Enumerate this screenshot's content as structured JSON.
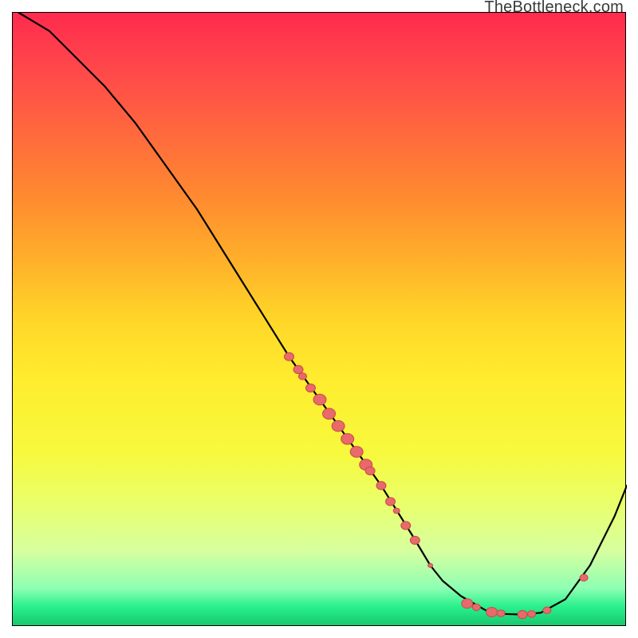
{
  "watermark": "TheBottleneck.com",
  "chart_data": {
    "type": "line",
    "title": "",
    "xlabel": "",
    "ylabel": "",
    "xlim": [
      0,
      100
    ],
    "ylim": [
      0,
      100
    ],
    "grid": false,
    "series": [
      {
        "name": "curve",
        "x": [
          1,
          6,
          10,
          15,
          20,
          25,
          30,
          35,
          40,
          45,
          50,
          55,
          60,
          65,
          68,
          70,
          73,
          77,
          80,
          83,
          86,
          90,
          94,
          98,
          100
        ],
        "y": [
          100,
          97,
          93,
          88,
          82,
          75,
          68,
          60,
          52,
          44,
          37,
          30,
          23,
          15,
          10,
          7.5,
          5,
          2.7,
          2.1,
          2.0,
          2.3,
          4.5,
          10,
          18,
          23
        ]
      }
    ],
    "markers": [
      {
        "x": 45.0,
        "y": 44.0,
        "r": 6
      },
      {
        "x": 46.5,
        "y": 41.9,
        "r": 6
      },
      {
        "x": 47.2,
        "y": 40.8,
        "r": 5
      },
      {
        "x": 48.5,
        "y": 38.9,
        "r": 6
      },
      {
        "x": 50.0,
        "y": 37.0,
        "r": 8
      },
      {
        "x": 51.5,
        "y": 34.7,
        "r": 8
      },
      {
        "x": 53.0,
        "y": 32.7,
        "r": 8
      },
      {
        "x": 54.5,
        "y": 30.6,
        "r": 8
      },
      {
        "x": 56.0,
        "y": 28.5,
        "r": 8
      },
      {
        "x": 57.5,
        "y": 26.4,
        "r": 8
      },
      {
        "x": 58.2,
        "y": 25.4,
        "r": 6
      },
      {
        "x": 60.0,
        "y": 23.0,
        "r": 6
      },
      {
        "x": 61.5,
        "y": 20.4,
        "r": 6
      },
      {
        "x": 62.5,
        "y": 18.9,
        "r": 4
      },
      {
        "x": 64.0,
        "y": 16.5,
        "r": 6
      },
      {
        "x": 65.5,
        "y": 14.1,
        "r": 6
      },
      {
        "x": 68.0,
        "y": 10.0,
        "r": 3
      },
      {
        "x": 74.0,
        "y": 3.8,
        "r": 7
      },
      {
        "x": 75.5,
        "y": 3.2,
        "r": 5
      },
      {
        "x": 78.0,
        "y": 2.4,
        "r": 7
      },
      {
        "x": 79.5,
        "y": 2.2,
        "r": 5
      },
      {
        "x": 83.0,
        "y": 2.0,
        "r": 6
      },
      {
        "x": 84.5,
        "y": 2.1,
        "r": 5
      },
      {
        "x": 87.0,
        "y": 2.7,
        "r": 5
      },
      {
        "x": 93.0,
        "y": 8.0,
        "r": 5
      }
    ]
  }
}
